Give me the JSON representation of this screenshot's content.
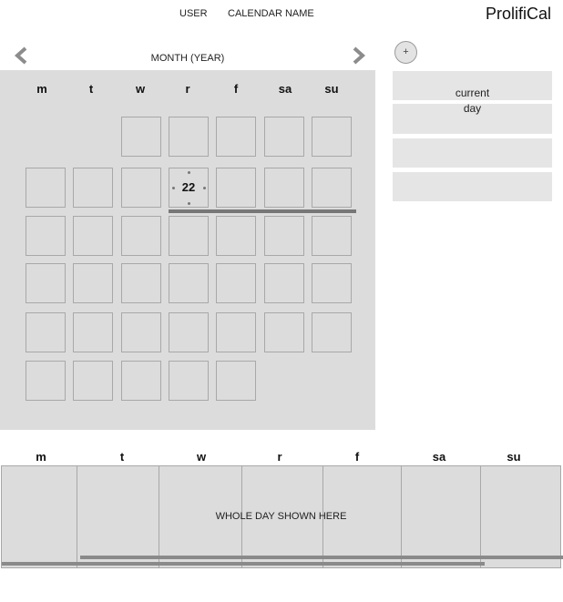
{
  "header": {
    "user_label": "USER",
    "calendar_name": "CALENDAR NAME",
    "app_name": "ProlifiCal"
  },
  "month_view": {
    "title": "MONTH (YEAR)",
    "add_label": "+",
    "weekday_labels": [
      "m",
      "t",
      "w",
      "r",
      "f",
      "sa",
      "su"
    ],
    "selected_day": "22"
  },
  "side_panel": {
    "current_day_label": "current\nday"
  },
  "week_view": {
    "weekday_labels": [
      "m",
      "t",
      "w",
      "r",
      "f",
      "sa",
      "su"
    ],
    "placeholder": "WHOLE DAY SHOWN HERE"
  }
}
